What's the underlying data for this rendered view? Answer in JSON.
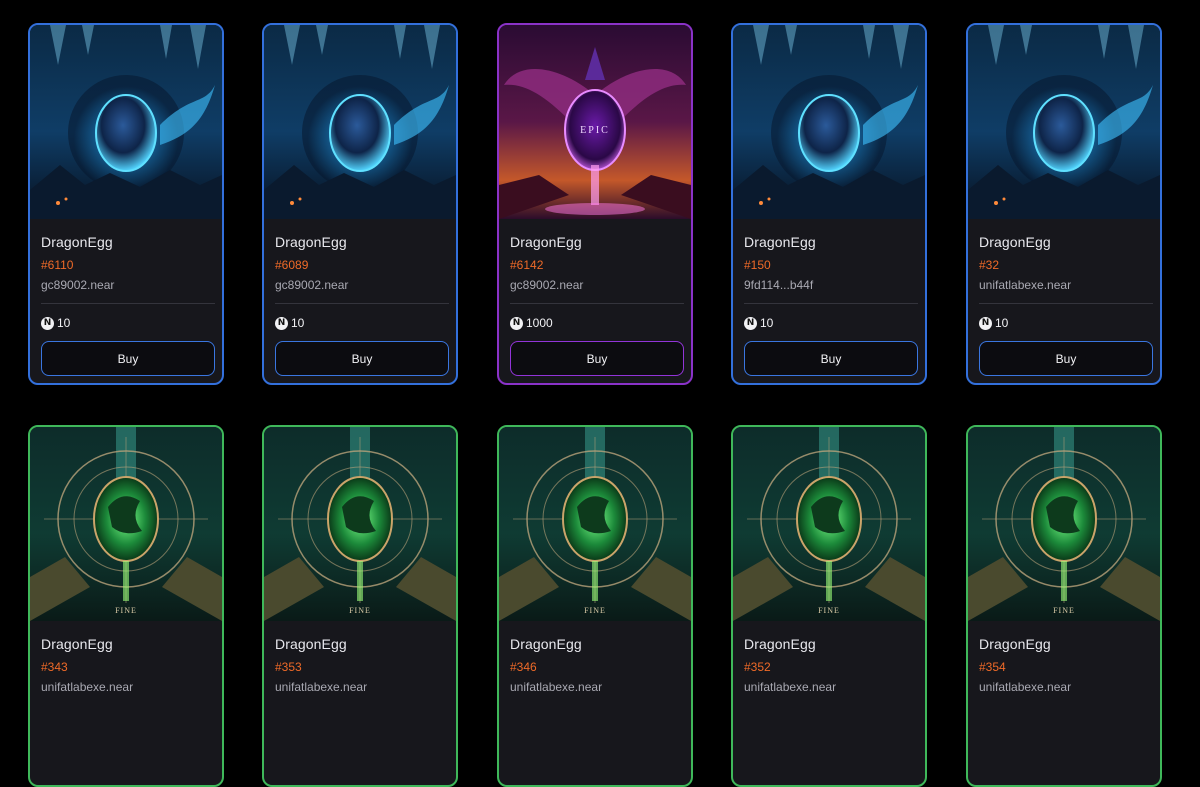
{
  "cards": [
    {
      "collection": "DragonEgg",
      "token_id": "#6110",
      "owner": "gc89002.near",
      "price": "10",
      "buy_label": "Buy",
      "rarity": "rare"
    },
    {
      "collection": "DragonEgg",
      "token_id": "#6089",
      "owner": "gc89002.near",
      "price": "10",
      "buy_label": "Buy",
      "rarity": "rare"
    },
    {
      "collection": "DragonEgg",
      "token_id": "#6142",
      "owner": "gc89002.near",
      "price": "1000",
      "buy_label": "Buy",
      "rarity": "epic",
      "art_label": "EPIC"
    },
    {
      "collection": "DragonEgg",
      "token_id": "#150",
      "owner": "9fd114...b44f",
      "price": "10",
      "buy_label": "Buy",
      "rarity": "rare"
    },
    {
      "collection": "DragonEgg",
      "token_id": "#32",
      "owner": "unifatlabexe.near",
      "price": "10",
      "buy_label": "Buy",
      "rarity": "rare"
    },
    {
      "collection": "DragonEgg",
      "token_id": "#343",
      "owner": "unifatlabexe.near",
      "rarity": "fine",
      "art_label": "FINE"
    },
    {
      "collection": "DragonEgg",
      "token_id": "#353",
      "owner": "unifatlabexe.near",
      "rarity": "fine",
      "art_label": "FINE"
    },
    {
      "collection": "DragonEgg",
      "token_id": "#346",
      "owner": "unifatlabexe.near",
      "rarity": "fine",
      "art_label": "FINE"
    },
    {
      "collection": "DragonEgg",
      "token_id": "#352",
      "owner": "unifatlabexe.near",
      "rarity": "fine",
      "art_label": "FINE"
    },
    {
      "collection": "DragonEgg",
      "token_id": "#354",
      "owner": "unifatlabexe.near",
      "rarity": "fine",
      "art_label": "FINE"
    }
  ],
  "currency_icon": "near-logo-icon",
  "colors": {
    "rare_border": "#3370dc",
    "epic_border": "#8a32c8",
    "fine_border": "#3fb85a",
    "token_id": "#ef6a28",
    "card_bg": "#17171c",
    "page_bg": "#000000"
  }
}
